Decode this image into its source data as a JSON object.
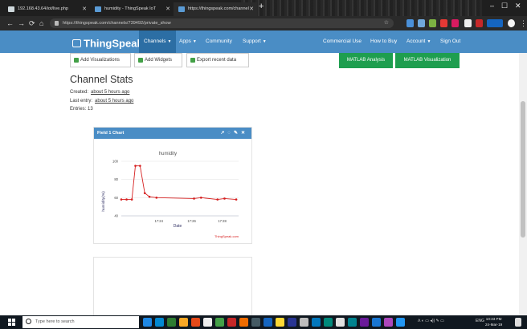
{
  "browser": {
    "tabs": [
      {
        "title": "192.168.43.64/iot/live.php"
      },
      {
        "title": "humidity - ThingSpeak IoT"
      },
      {
        "title": "https://thingspeak.com/channel"
      }
    ],
    "url": "https://thingspeak.com/channels/739492/private_show"
  },
  "nav": {
    "logo": "ThingSpeak",
    "logo_tm": "™",
    "left_items": [
      "Channels",
      "Apps",
      "Community",
      "Support"
    ],
    "right_items": [
      "Commercial Use",
      "How to Buy",
      "Account",
      "Sign Out"
    ]
  },
  "toolbar": {
    "add_visualizations": "Add Visualizations",
    "add_widgets": "Add Widgets",
    "export_recent": "Export recent data",
    "matlab_analysis": "MATLAB Analysis",
    "matlab_visualization": "MATLAB Visualization"
  },
  "stats": {
    "heading": "Channel Stats",
    "created_label": "Created:",
    "created_value": "about 5 hours ago",
    "last_entry_label": "Last entry:",
    "last_entry_value": "about 5 hours ago",
    "entries": "Entries: 13"
  },
  "panel": {
    "title": "Field 1 Chart"
  },
  "chart_data": {
    "type": "line",
    "title": "humidity",
    "xlabel": "Date",
    "ylabel": "humidity(%)",
    "ylim": [
      40,
      100
    ],
    "yticks": [
      40,
      60,
      80,
      100
    ],
    "xticks": [
      "17:24",
      "17:26",
      "17:28"
    ],
    "watermark": "ThingSpeak.com",
    "color": "#d62020",
    "series": [
      {
        "x": [
          0.0,
          0.045,
          0.09,
          0.12,
          0.16,
          0.2,
          0.24,
          0.3,
          0.62,
          0.68,
          0.82,
          0.88,
          0.98
        ],
        "values": [
          58,
          58,
          58,
          95,
          95,
          65,
          61,
          60,
          59,
          60,
          58,
          59,
          58
        ]
      }
    ]
  },
  "taskbar": {
    "search_placeholder": "Type here to search",
    "lang": "ENG",
    "time": "10:33 PM",
    "date": "24-Mar-19"
  }
}
